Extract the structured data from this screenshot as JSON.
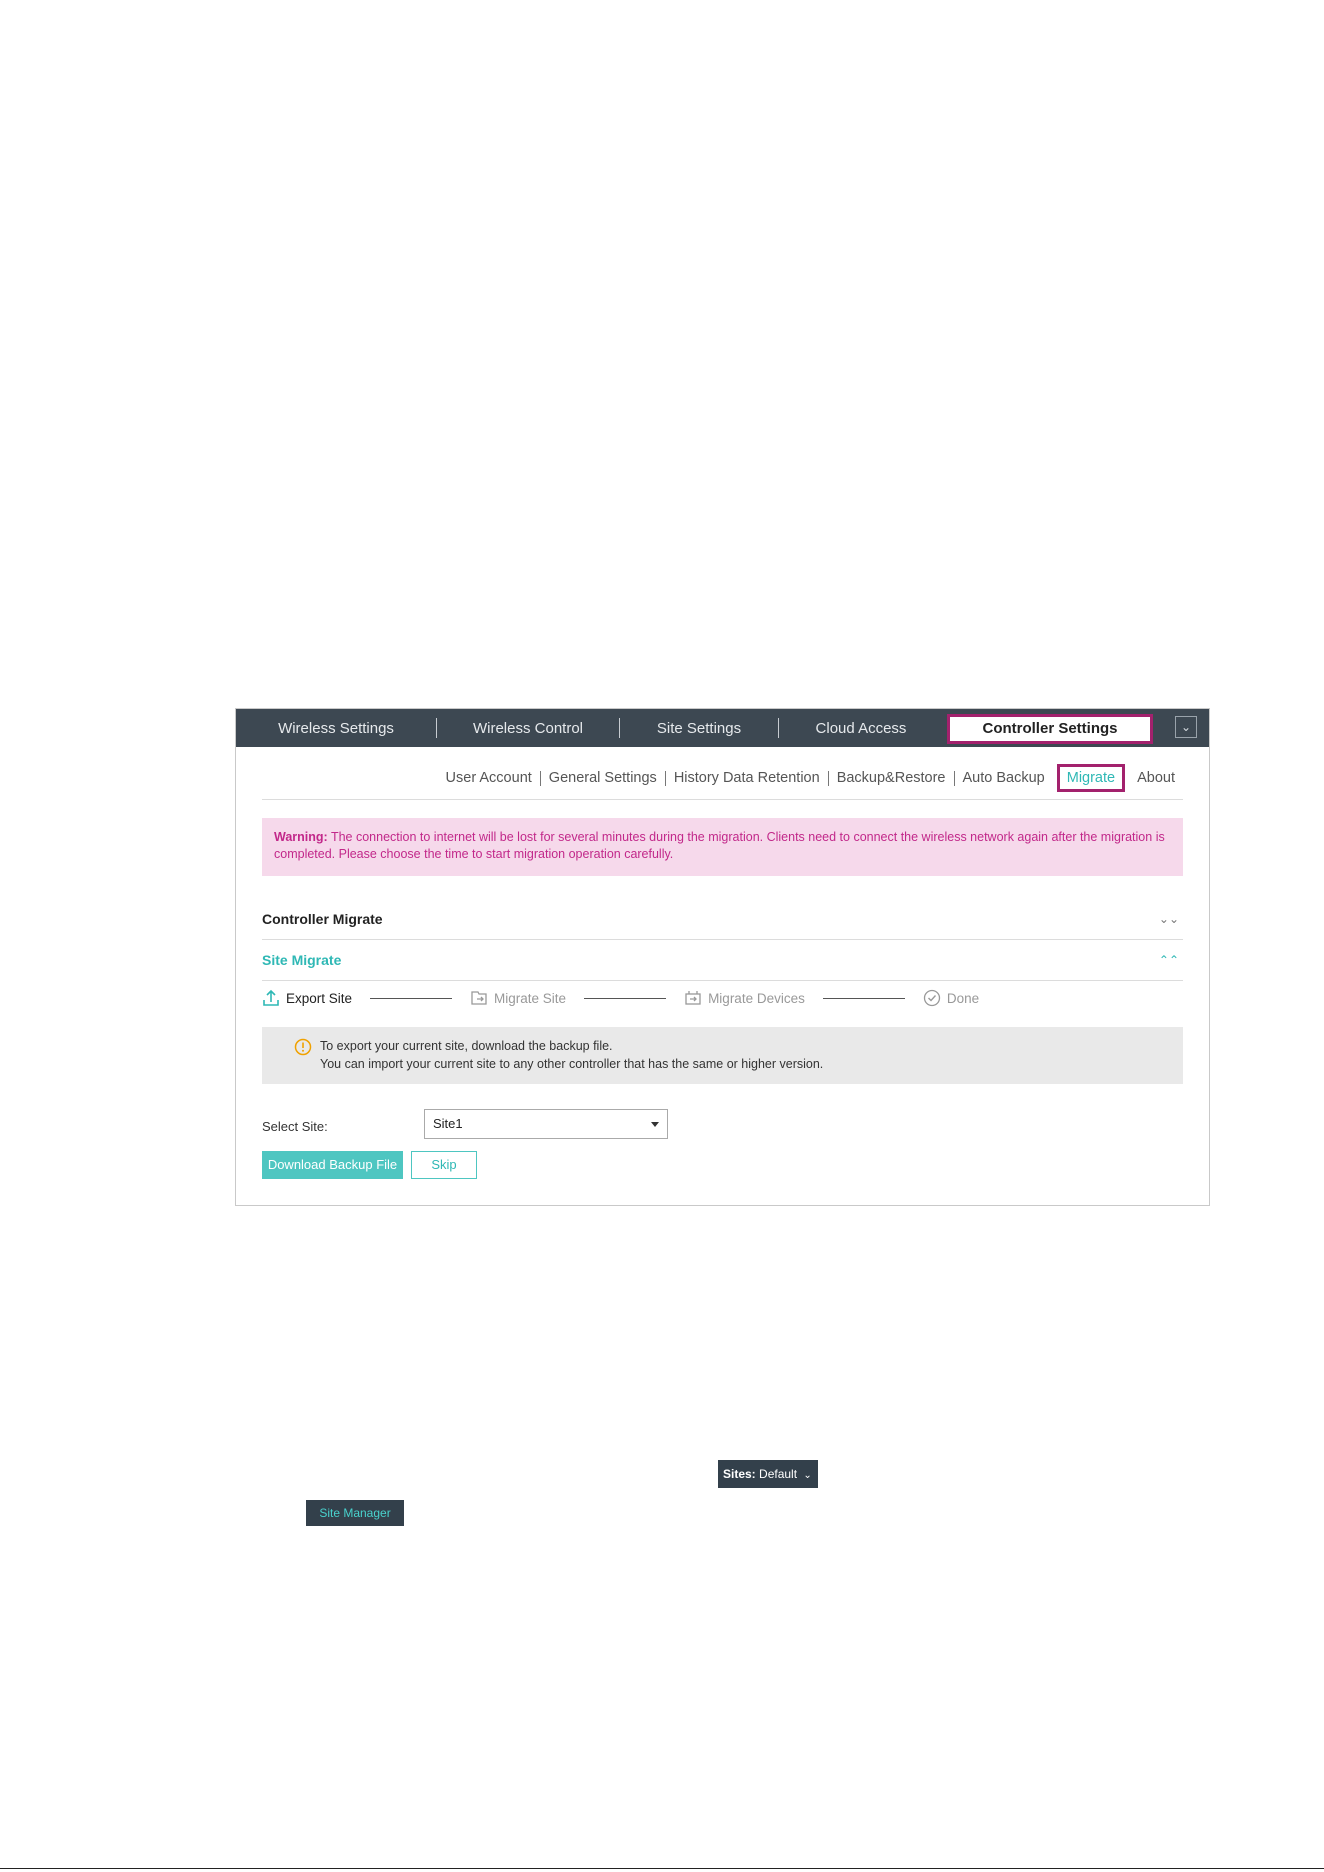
{
  "topnav": {
    "tabs": [
      {
        "label": "Wireless Settings"
      },
      {
        "label": "Wireless Control"
      },
      {
        "label": "Site Settings"
      },
      {
        "label": "Cloud Access"
      },
      {
        "label": "Controller Settings",
        "active": true
      }
    ],
    "collapse_icon": "chevron-down-icon"
  },
  "subnav": {
    "items": [
      {
        "label": "User Account"
      },
      {
        "label": "General Settings"
      },
      {
        "label": "History Data Retention"
      },
      {
        "label": "Backup&Restore"
      },
      {
        "label": "Auto Backup"
      },
      {
        "label": "Migrate",
        "active": true
      },
      {
        "label": "About"
      }
    ]
  },
  "warning": {
    "prefix": "Warning:",
    "text": " The connection to internet will be lost for several minutes during the migration. Clients need to connect the wireless network again after the migration is completed. Please choose the time to start migration operation carefully."
  },
  "sections": {
    "controller_migrate": "Controller Migrate",
    "site_migrate": "Site Migrate"
  },
  "steps": [
    {
      "label": "Export Site",
      "icon": "upload-icon",
      "current": true
    },
    {
      "label": "Migrate Site",
      "icon": "migrate-site-icon"
    },
    {
      "label": "Migrate Devices",
      "icon": "migrate-devices-icon"
    },
    {
      "label": "Done",
      "icon": "check-circle-icon"
    }
  ],
  "info": {
    "line1": "To export your current site, download the backup file.",
    "line2": "You can import your current site to any other controller that has the same or higher version."
  },
  "form": {
    "select_label": "Select Site:",
    "select_value": "Site1"
  },
  "buttons": {
    "download": "Download Backup File",
    "skip": "Skip"
  },
  "snippets": {
    "sites_label": "Sites:",
    "sites_value": "Default",
    "site_manager": "Site Manager"
  },
  "colors": {
    "accent": "#2fb8b5",
    "highlight": "#a3216d",
    "nav_bg": "#3d4852",
    "warning_text": "#c2288a"
  }
}
